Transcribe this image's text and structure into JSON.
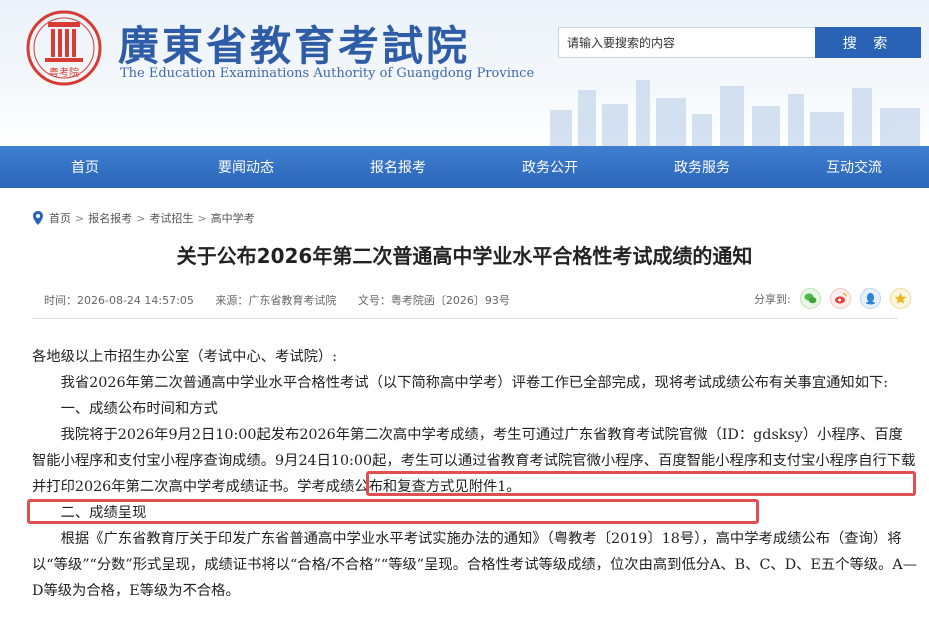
{
  "header": {
    "site_title": "廣東省教育考試院",
    "site_subtitle": "The Education Examinations Authority of Guangdong Province",
    "logo_text": "粤考院",
    "search": {
      "placeholder": "请输入要搜索的内容",
      "button_label": "搜 索"
    }
  },
  "nav": {
    "items": [
      "首页",
      "要闻动态",
      "报名报考",
      "政务公开",
      "政务服务",
      "互动交流"
    ]
  },
  "breadcrumb": [
    "首页",
    "报名报考",
    "考试招生",
    "高中学考"
  ],
  "article": {
    "title": "关于公布2026年第二次普通高中学业水平合格性考试成绩的通知",
    "meta": {
      "time": "时间：2026-08-24 14:57:05",
      "source": "来源：广东省教育考试院",
      "doc_no": "文号：粤考院函〔2026〕93号"
    },
    "share_label": "分享到:",
    "share_icons": [
      "wechat-icon",
      "weibo-icon",
      "qq-icon",
      "qzone-icon"
    ],
    "paragraphs": {
      "p1": "各地级以上市招生办公室（考试中心、考试院）:",
      "p2": "我省2026年第二次普通高中学业水平合格性考试（以下简称高中学考）评卷工作已全部完成，现将考试成绩公布有关事宜通知如下:",
      "p3": "一、成绩公布时间和方式",
      "p4": "我院将于2026年9月2日10:00起发布2026年第二次高中学考成绩，考生可通过广东省教育考试院官微（ID：gdsksy）小程序、百度智能小程序和支付宝小程序查询成绩。9月24日10:00起，考生可以通过省教育考试院官微小程序、百度智能小程序和支付宝小程序自行下载并打印2026年第二次高中学考成绩证书。学考成绩公布和复查方式见附件1。",
      "p5": "二、成绩呈现",
      "p6": "根据《广东省教育厅关于印发广东省普通高中学业水平考试实施办法的通知》（粤教考〔2019〕18号），高中学考成绩公布（查询）将以“等级”“分数”形式呈现，成绩证书将以“合格/不合格”“等级”呈现。合格性考试等级成绩，位次由高到低分A、B、C、D、E五个等级。A—D等级为合格，E等级为不合格。"
    }
  },
  "colors": {
    "brand_blue": "#2a63b5",
    "nav_blue": "#3574c6",
    "highlight_red": "#e15050"
  }
}
